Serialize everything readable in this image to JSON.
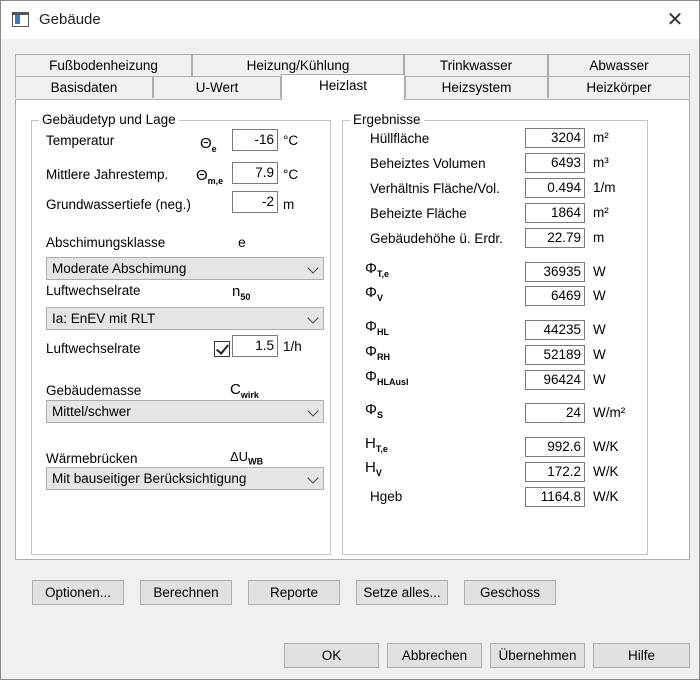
{
  "window": {
    "title": "Gebäude"
  },
  "tabs_row1": [
    "Fußbodenheizung",
    "Heizung/Kühlung",
    "Trinkwasser",
    "Abwasser"
  ],
  "tabs_row2": [
    "Basisdaten",
    "U-Wert",
    "Heizlast",
    "Heizsystem",
    "Heizkörper"
  ],
  "active_tab": "Heizlast",
  "left": {
    "group_title": "Gebäudetyp und Lage",
    "temperature": {
      "label": "Temperatur",
      "symbol": "Θ",
      "sub": "e",
      "value": "-16",
      "unit": "°C"
    },
    "annual_temp": {
      "label": "Mittlere Jahrestemp.",
      "symbol": "Θ",
      "sub": "m,e",
      "value": "7.9",
      "unit": "°C"
    },
    "groundwater": {
      "label": "Grundwassertiefe (neg.)",
      "value": "-2",
      "unit": "m"
    },
    "shielding": {
      "label": "Abschimungsklasse",
      "symbol": "e",
      "selected": "Moderate Abschimung"
    },
    "air_change": {
      "label": "Luftwechselrate",
      "symbol": "n",
      "sub": "50",
      "selected": "Ia: EnEV mit RLT"
    },
    "air_rate": {
      "label": "Luftwechselrate",
      "checked": true,
      "value": "1.5",
      "unit": "1/h"
    },
    "building_mass": {
      "label": "Gebäudemasse",
      "symbol": "C",
      "sub": "wirk",
      "selected": "Mittel/schwer"
    },
    "thermal_bridges": {
      "label": "Wärmebrücken",
      "symbol": "ΔU",
      "sub": "WB",
      "selected": "Mit bauseitiger Berücksichtigung"
    }
  },
  "results": {
    "group_title": "Ergebnisse",
    "hull_area": {
      "label": "Hüllfläche",
      "value": "3204",
      "unit": "m²"
    },
    "heated_volume": {
      "label": "Beheiztes Volumen",
      "value": "6493",
      "unit": "m³"
    },
    "ratio": {
      "label": "Verhältnis Fläche/Vol.",
      "value": "0.494",
      "unit": "1/m"
    },
    "heated_area": {
      "label": "Beheizte Fläche",
      "value": "1864",
      "unit": "m²"
    },
    "height": {
      "label": "Gebäudehöhe ü. Erdr.",
      "value": "22.79",
      "unit": "m"
    },
    "phi_te": {
      "symbol": "Φ",
      "sub": "T,e",
      "value": "36935",
      "unit": "W"
    },
    "phi_v": {
      "symbol": "Φ",
      "sub": "V",
      "value": "6469",
      "unit": "W"
    },
    "phi_hl": {
      "symbol": "Φ",
      "sub": "HL",
      "value": "44235",
      "unit": "W"
    },
    "phi_rh": {
      "symbol": "Φ",
      "sub": "RH",
      "value": "52189",
      "unit": "W"
    },
    "phi_hlausl": {
      "symbol": "Φ",
      "sub": "HLAusl",
      "value": "96424",
      "unit": "W"
    },
    "phi_s": {
      "symbol": "Φ",
      "sub": "S",
      "value": "24",
      "unit": "W/m²"
    },
    "h_te": {
      "symbol": "H",
      "sub": "T,e",
      "value": "992.6",
      "unit": "W/K"
    },
    "h_v": {
      "symbol": "H",
      "sub": "V",
      "value": "172.2",
      "unit": "W/K"
    },
    "hgeb": {
      "label": "Hgeb",
      "value": "1164.8",
      "unit": "W/K"
    }
  },
  "actions": [
    "Optionen...",
    "Berechnen",
    "Reporte",
    "Setze alles...",
    "Geschoss"
  ],
  "footer": [
    "OK",
    "Abbrechen",
    "Übernehmen",
    "Hilfe"
  ]
}
